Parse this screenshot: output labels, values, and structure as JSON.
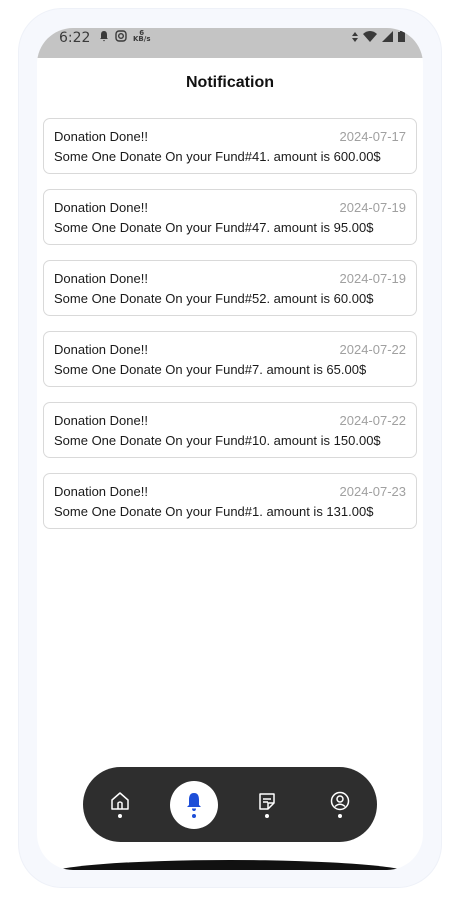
{
  "status_bar": {
    "time": "6:22",
    "speed_value": "6",
    "speed_unit": "KB/s"
  },
  "header": {
    "title": "Notification"
  },
  "notifications": [
    {
      "title": "Donation Done!!",
      "date": "2024-07-17",
      "message": "Some One Donate On your Fund#41. amount is 600.00$"
    },
    {
      "title": "Donation Done!!",
      "date": "2024-07-19",
      "message": "Some One Donate On your Fund#47. amount is 95.00$"
    },
    {
      "title": "Donation Done!!",
      "date": "2024-07-19",
      "message": "Some One Donate On your Fund#52. amount is 60.00$"
    },
    {
      "title": "Donation Done!!",
      "date": "2024-07-22",
      "message": "Some One Donate On your Fund#7. amount is 65.00$"
    },
    {
      "title": "Donation Done!!",
      "date": "2024-07-22",
      "message": "Some One Donate On your Fund#10. amount is 150.00$"
    },
    {
      "title": "Donation Done!!",
      "date": "2024-07-23",
      "message": "Some One Donate On your Fund#1. amount is 131.00$"
    }
  ],
  "bottom_nav": {
    "items": [
      {
        "icon": "home-icon",
        "active": false
      },
      {
        "icon": "bell-icon",
        "active": true
      },
      {
        "icon": "notes-icon",
        "active": false
      },
      {
        "icon": "profile-icon",
        "active": false
      }
    ],
    "active_color": "#1d4ed8",
    "bar_color": "#2e2e2e"
  }
}
